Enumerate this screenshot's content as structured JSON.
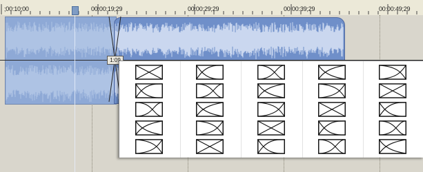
{
  "ruler": {
    "timecodes": [
      {
        "label": ";00:10;00",
        "name": "timecode-00-10-00"
      },
      {
        "label": "00:00:19;29",
        "name": "timecode-00-19-29"
      },
      {
        "label": "00:00:29;29",
        "name": "timecode-00-29-29"
      },
      {
        "label": "00:00:39;29",
        "name": "timecode-00-39-29"
      },
      {
        "label": "00:00:49;29",
        "name": "timecode-00-49-29"
      }
    ]
  },
  "track": {
    "volume_label": "1:09"
  },
  "fade_menu": {
    "columns": 5,
    "rows": 5,
    "icon": "crossfade-curve-icon"
  },
  "colors": {
    "clip_a": "#8ea9d6",
    "clip_b": "#6f8fc9",
    "waveform": "#dfe8f7",
    "ruler_bg": "#ece9d8",
    "panel_bg": "#ffffff"
  }
}
